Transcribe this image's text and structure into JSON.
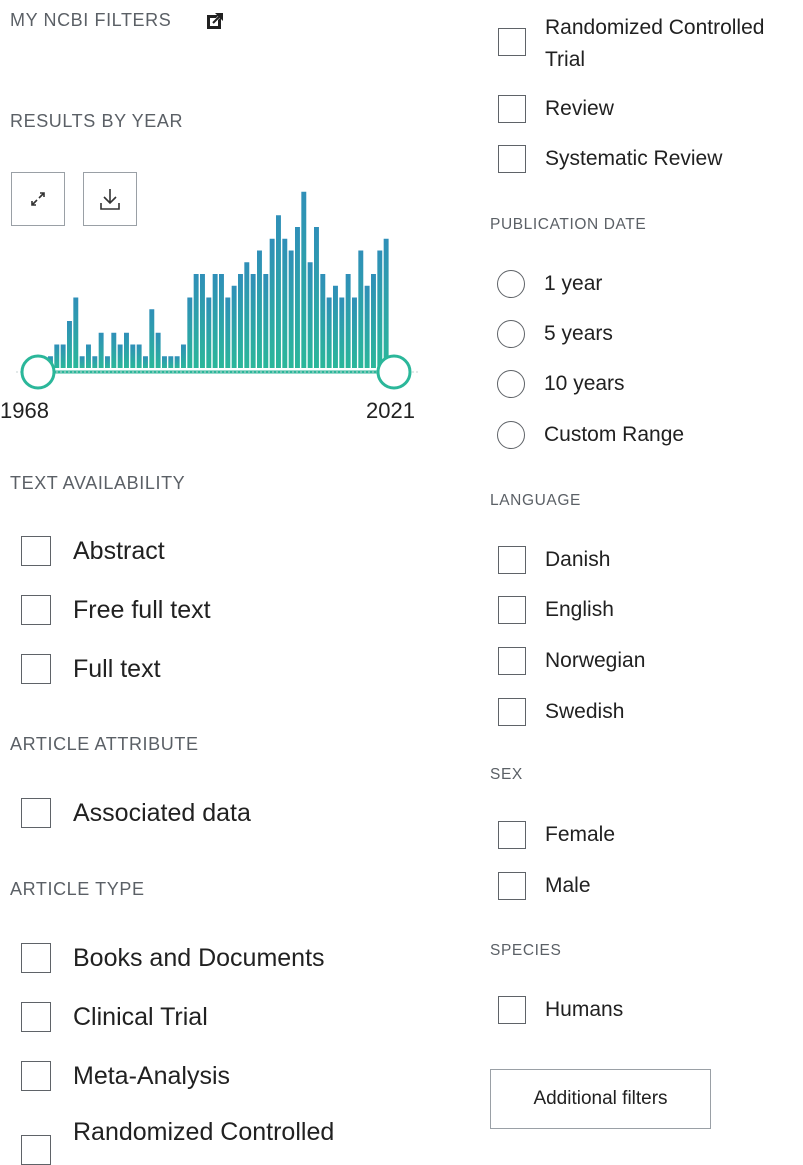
{
  "my_ncbi": {
    "title": "MY NCBI FILTERS"
  },
  "results_by_year": {
    "heading": "RESULTS BY YEAR",
    "start_label": "1968",
    "end_label": "2021"
  },
  "chart_data": {
    "type": "bar",
    "x": [
      1968,
      1969,
      1970,
      1971,
      1972,
      1973,
      1974,
      1975,
      1976,
      1977,
      1978,
      1979,
      1980,
      1981,
      1982,
      1983,
      1984,
      1985,
      1986,
      1987,
      1988,
      1989,
      1990,
      1991,
      1992,
      1993,
      1994,
      1995,
      1996,
      1997,
      1998,
      1999,
      2000,
      2001,
      2002,
      2003,
      2004,
      2005,
      2006,
      2007,
      2008,
      2009,
      2010,
      2011,
      2012,
      2013,
      2014,
      2015,
      2016,
      2017,
      2018,
      2019,
      2020,
      2021
    ],
    "values": [
      1,
      2,
      2,
      4,
      6,
      1,
      2,
      1,
      3,
      1,
      3,
      2,
      3,
      2,
      2,
      1,
      5,
      3,
      1,
      1,
      1,
      2,
      6,
      8,
      8,
      6,
      8,
      8,
      6,
      7,
      8,
      9,
      8,
      10,
      8,
      11,
      13,
      11,
      10,
      12,
      15,
      9,
      12,
      8,
      6,
      7,
      6,
      8,
      6,
      10,
      7,
      8,
      10,
      11
    ],
    "xlabel": "",
    "ylabel": "",
    "ylim": [
      0,
      16
    ]
  },
  "text_availability": {
    "heading": "TEXT AVAILABILITY",
    "items": [
      "Abstract",
      "Free full text",
      "Full text"
    ]
  },
  "article_attribute": {
    "heading": "ARTICLE ATTRIBUTE",
    "items": [
      "Associated data"
    ]
  },
  "article_type": {
    "heading": "ARTICLE TYPE",
    "items": [
      "Books and Documents",
      "Clinical Trial",
      "Meta-Analysis",
      "Randomized Controlled",
      "Trial",
      "Review",
      "Systematic Review"
    ]
  },
  "publication_date": {
    "heading": "PUBLICATION DATE",
    "options": [
      "1 year",
      "5 years",
      "10 years",
      "Custom Range"
    ]
  },
  "language": {
    "heading": "LANGUAGE",
    "items": [
      "Danish",
      "English",
      "Norwegian",
      "Swedish"
    ]
  },
  "sex": {
    "heading": "SEX",
    "items": [
      "Female",
      "Male"
    ]
  },
  "species": {
    "heading": "SPECIES",
    "items": [
      "Humans"
    ]
  },
  "additional_filters": {
    "label": "Additional filters"
  },
  "colors": {
    "bar_top": "#2f8fb8",
    "bar_bottom": "#2bb79a",
    "slider": "#2bb79a"
  }
}
